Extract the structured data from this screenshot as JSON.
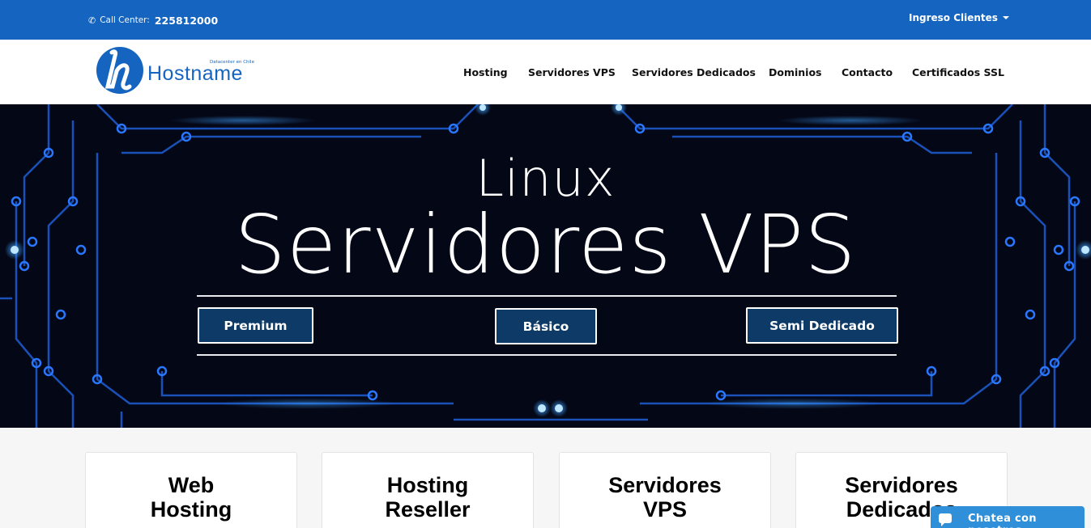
{
  "topbar": {
    "call_label": "Call Center:",
    "phone_number": "225812000",
    "login_label": "Ingreso Clientes"
  },
  "logo": {
    "name": "Hostname",
    "tagline": "Datacenter en Chile"
  },
  "nav": {
    "items": [
      {
        "label": "Hosting"
      },
      {
        "label": "Servidores VPS"
      },
      {
        "label": "Servidores Dedicados"
      },
      {
        "label": "Dominios"
      },
      {
        "label": "Contacto"
      },
      {
        "label": "Certificados SSL"
      }
    ]
  },
  "hero": {
    "subtitle": "Linux",
    "title": "Servidores VPS",
    "plans": [
      {
        "label": "Premium"
      },
      {
        "label": "Básico"
      },
      {
        "label": "Semi Dedicado"
      }
    ]
  },
  "cards": [
    {
      "line1": "Web",
      "line2": "Hosting"
    },
    {
      "line1": "Hosting",
      "line2": "Reseller"
    },
    {
      "line1": "Servidores",
      "line2": "VPS"
    },
    {
      "line1": "Servidores",
      "line2": "Dedicados"
    }
  ],
  "chat": {
    "label": "Chatea con nosotros"
  },
  "colors": {
    "brand_blue": "#1565c0",
    "hero_bg": "#040716",
    "plan_button": "#0d3a66",
    "chat_blue": "#2f8fd8"
  }
}
